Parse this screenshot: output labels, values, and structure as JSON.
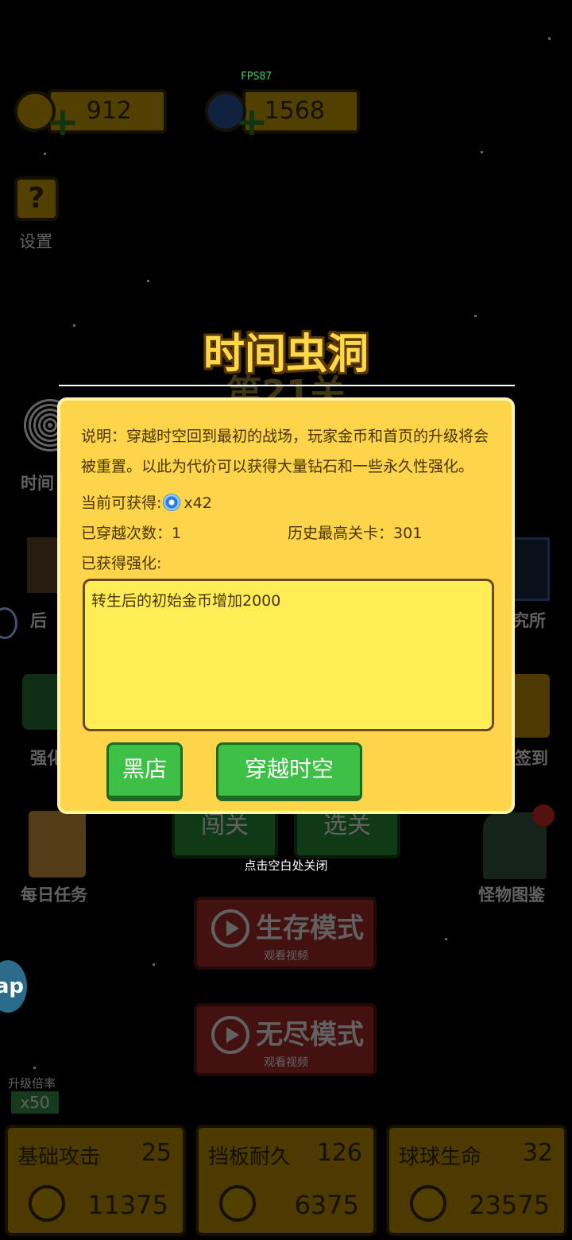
{
  "hud": {
    "fps": "FPS87",
    "gold": "912",
    "gems": "1568",
    "settings_label": "设置",
    "settings_icon": "?"
  },
  "background": {
    "side_left": [
      "时间",
      "后",
      "强化",
      "每日任务"
    ],
    "side_right": [
      "究所",
      "签到",
      "怪物图鉴"
    ],
    "play_buttons": [
      "闯关",
      "选关"
    ],
    "survival": {
      "title": "生存模式",
      "sub": "观看视频"
    },
    "endless": {
      "title": "无尽模式",
      "sub": "观看视频"
    },
    "bubble": "ap",
    "multiplier": {
      "label": "升级倍率",
      "value": "x50"
    },
    "upgrades": [
      {
        "name": "基础攻击",
        "level": "25",
        "cost": "11375"
      },
      {
        "name": "挡板耐久",
        "level": "126",
        "cost": "6375"
      },
      {
        "name": "球球生命",
        "level": "32",
        "cost": "23575"
      }
    ]
  },
  "dialog": {
    "title": "时间虫洞",
    "ghost_sub": "第21关",
    "description": "说明：穿越时空回到最初的战场，玩家金币和首页的升级将会被重置。以此为代价可以获得大量钻石和一些永久性强化。",
    "obtain_label": "当前可获得:",
    "obtain_value": "x42",
    "travel_label": "已穿越次数：",
    "travel_value": "1",
    "best_label": "历史最高关卡：",
    "best_value": "301",
    "buffs_label": "已获得强化:",
    "buffs_text": "转生后的初始金币增加2000",
    "black_shop": "黑店",
    "travel_button": "穿越时空",
    "close_hint": "点击空白处关闭"
  }
}
